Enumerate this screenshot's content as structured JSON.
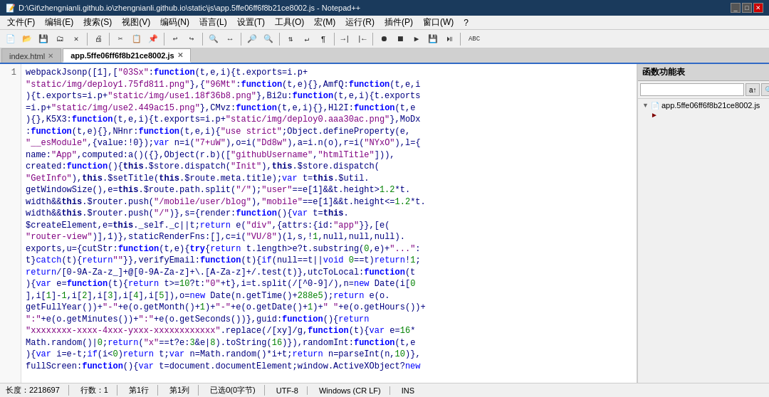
{
  "titleBar": {
    "title": "D:\\Git\\zhengnianli.github.io\\zhengnianli.github.io\\static\\js\\app.5ffe06ff6f8b21ce8002.js - Notepad++",
    "controls": [
      "_",
      "□",
      "✕"
    ]
  },
  "menuBar": {
    "items": [
      "文件(F)",
      "编辑(E)",
      "搜索(S)",
      "视图(V)",
      "编码(N)",
      "语言(L)",
      "设置(T)",
      "工具(O)",
      "宏(M)",
      "运行(R)",
      "插件(P)",
      "窗口(W)",
      "?"
    ]
  },
  "tabs": [
    {
      "label": "index.html",
      "active": false,
      "closable": true
    },
    {
      "label": "app.5ffe06ff6f8b21ce8002.js",
      "active": true,
      "closable": true
    }
  ],
  "lineNumbers": [
    "1"
  ],
  "codeContent": "webpackJsonp([1],[\"03Sx\":function(t,e,i){t.exports=i.p+\n\"static/img/deploy1.75fd811.png\"},{\"96Mt\":function(t,e){},AmfQ:function(t,e,i\n){t.exports=i.p+\"static/img/use1.18f36b8.png\"},Bi2u:function(t,e,i){t.exports\n=i.p+\"static/img/use2.449ac15.png\"},CMvz:function(t,e,i){},Hl2I:function(t,e\n){},K5X3:function(t,e,i){t.exports=i.p+\"static/img/deploy0.aaa30ac.png\"},MoDx\n:function(t,e){},NHnr:function(t,e,i){\"use strict\";Object.defineProperty(e,\n\"__esModule\",{value:!0});var n=i(\"7+uW\"),o=i(\"Dd8w\"),a=i.n(o),r=i(\"NYxO\"),l={\nname:\"App\",computed:a()({},Object(r.b)([\"githubUsername\",\"htmlTitle\"])),\ncreated:function(){this.$store.dispatch(\"Init\"),this.$store.dispatch(\n\"GetInfo\"),this.$setTitle(this.$route.meta.title);var t=this.$util.\ngetWindowSize(),e=this.$route.path.split(\"/\");\"user\"==e[1]&&t.height>1.2*t.\nwidth&&this.$router.push(\"/mobile/user/blog\"),\"mobile\"==e[1]&&t.height<=1.2*t.\nwidth&&this.$router.push(\"/\")},s={render:function(){var t=this.\n$createElement,e=this._self._c||t;return e(\"div\",{attrs:{id:\"app\"}},[e(\n\"router-view\")],1)},staticRenderFns:[],c=i(\"VU/8\")(l,s,!1,null,null,null).\nexports,u={cutStr:function(t,e){try{return t.length>e?t.substring(0,e)+\"...\":\nt}catch(t){return\"\"}},verifyEmail:function(t){if(null==t||void 0==t)return!1;\nreturn/[0-9A-Za-z_]+@[0-9A-Za-z]+\\.[A-Za-z]+/.test(t)},utcToLocal:function(t\n){var e=function(t){return t>=10?t:\"0\"+t},i=t.split(/[^0-9]/),n=new Date(i[0\n],i[1]-1,i[2],i[3],i[4],i[5]),o=new Date(n.getTime()+288e5);return e(o.\ngetFullYear())+\"-\"+e(o.getMonth()+1)+\"-\"+e(o.getDate()+1)+\" \"+e(o.getHours())+\n\":\"+e(o.getMinutes())+\":\"+e(o.getSeconds())},guid:function(){return\n\"xxxxxxxx-xxxx-4xxx-yxxx-xxxxxxxxxxxx\".replace(/[xy]/g,function(t){var e=16*\nMath.random()|0;return(\"x\"==t?e:3&e|8).toString(16)}),randomInt:function(t,e\n){var i=e-t;if(i<0)return t;var n=Math.random()*i+t;return n=parseInt(n,10)},\nfullScreen:function(){var t=document.documentElement;window.ActiveXObject?new",
  "rightPanel": {
    "title": "函数功能表",
    "searchPlaceholder": "",
    "searchButtons": [
      "a↑",
      "🔍"
    ],
    "treeItems": [
      {
        "label": "app.5ffe06ff6f8b21ce8002.js",
        "type": "file",
        "expanded": true,
        "selected": false,
        "indent": 0
      },
      {
        "label": "►",
        "type": "arrow",
        "indent": 1
      }
    ]
  },
  "statusBar": {
    "length": "长度：2218697",
    "lines": "行数：1",
    "ln": "第1行",
    "col": "第1列",
    "sel": "已选0(0字节)",
    "encoding": "UTF-8",
    "eol": "Windows (CR LF)",
    "insert": "INS"
  }
}
